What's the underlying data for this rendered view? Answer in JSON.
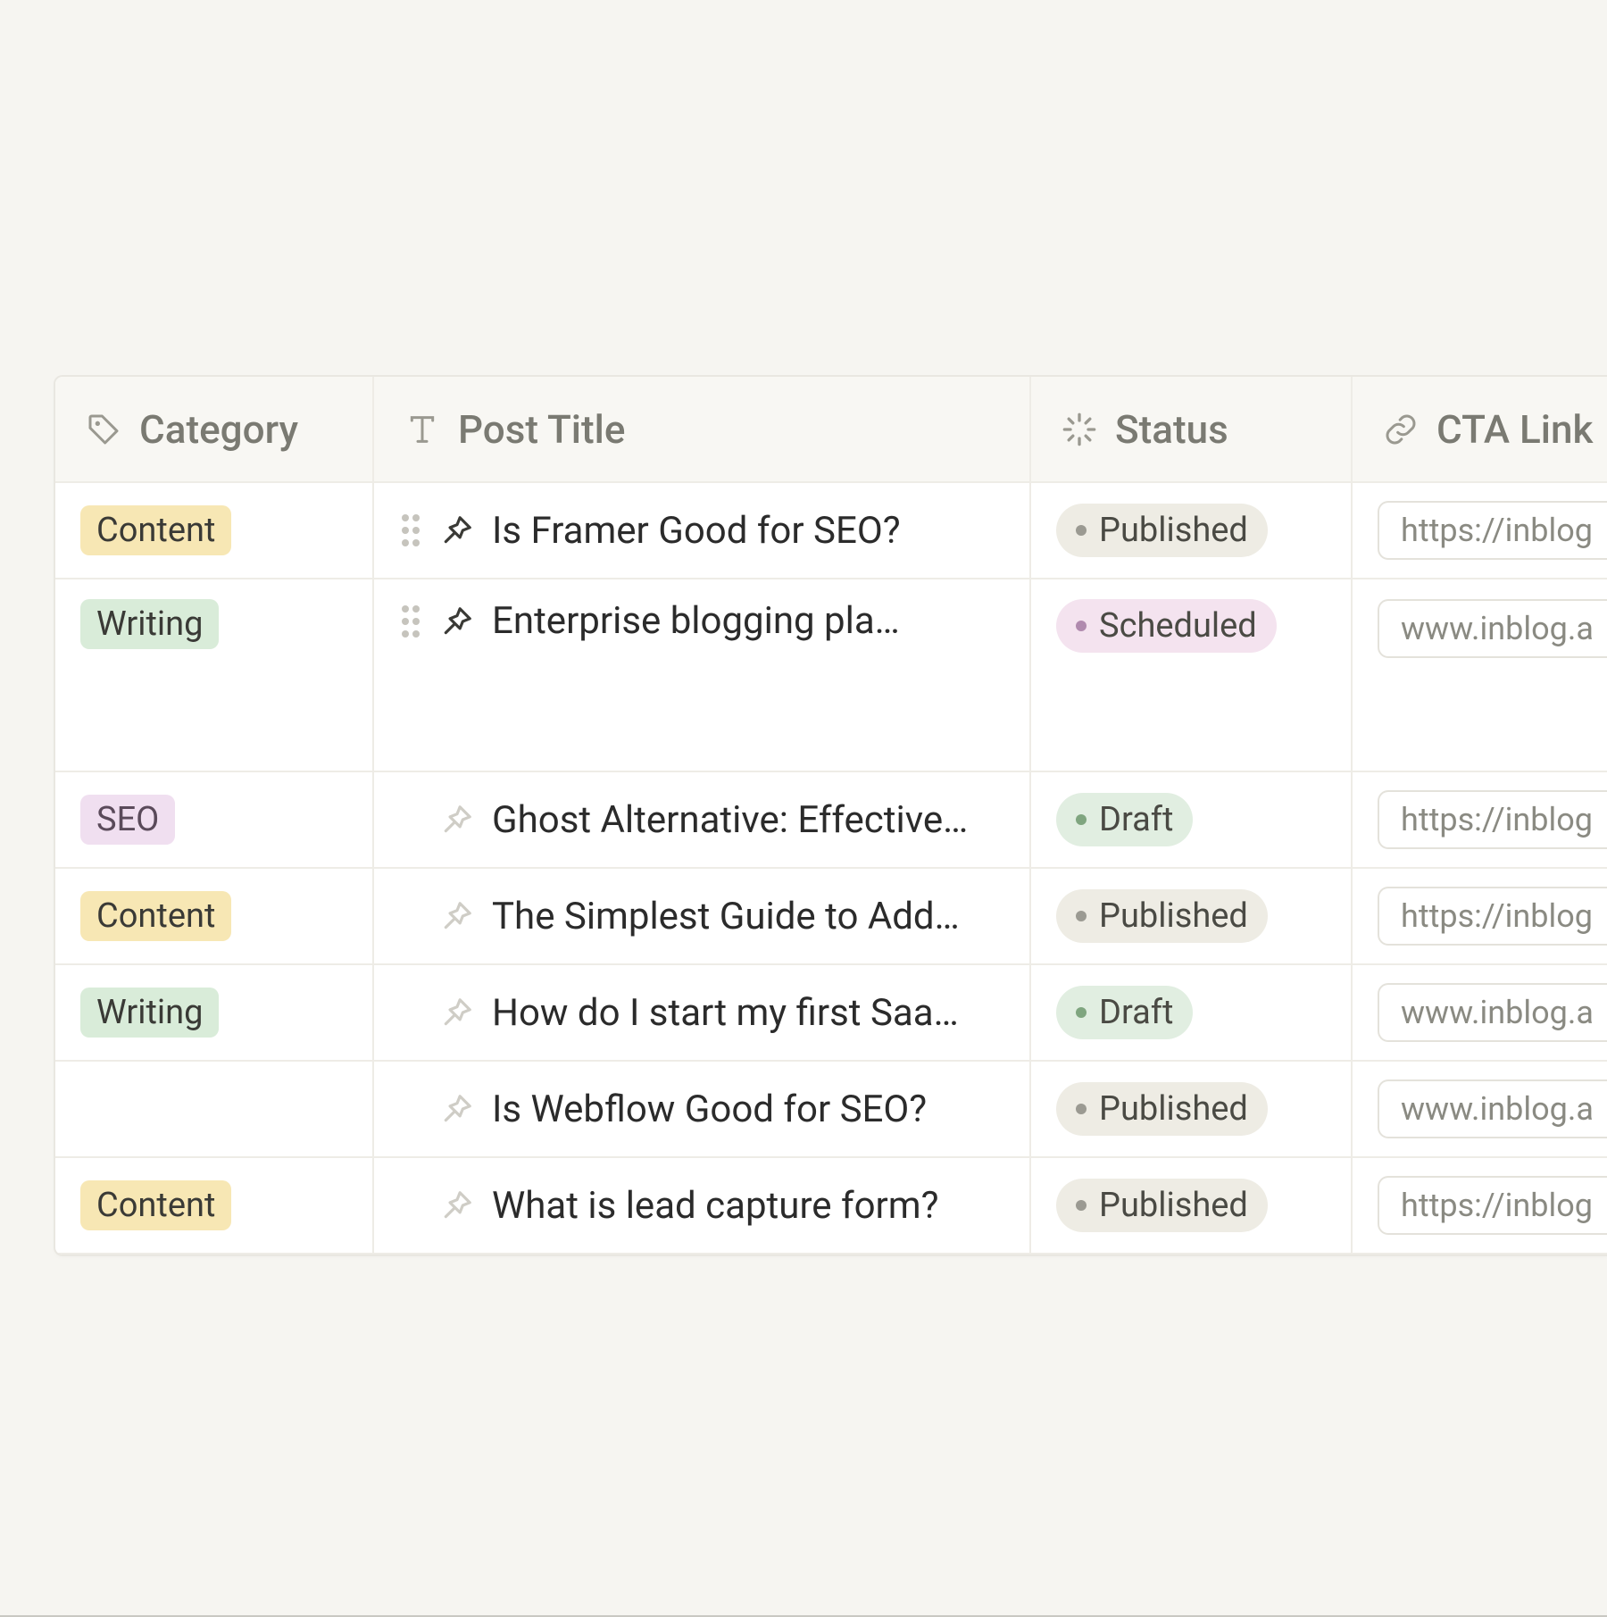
{
  "headers": {
    "category": "Category",
    "title": "Post Title",
    "status": "Status",
    "cta": "CTA Link"
  },
  "status_labels": {
    "published": "Published",
    "scheduled": "Scheduled",
    "draft": "Draft"
  },
  "categories": {
    "content": "Content",
    "writing": "Writing",
    "seo": "SEO"
  },
  "rows": [
    {
      "category": "content",
      "title": "Is Framer Good for SEO?",
      "status": "published",
      "link": "https://inblog",
      "drag": true,
      "pinned": true,
      "tall": false
    },
    {
      "category": "writing",
      "title": "Enterprise blogging pla…",
      "status": "scheduled",
      "link": "www.inblog.a",
      "drag": true,
      "pinned": true,
      "tall": true
    },
    {
      "category": "seo",
      "title": "Ghost Alternative: Effective…",
      "status": "draft",
      "link": "https://inblog",
      "drag": false,
      "pinned": false,
      "tall": false
    },
    {
      "category": "content",
      "title": "The Simplest Guide to Add…",
      "status": "published",
      "link": "https://inblog",
      "drag": false,
      "pinned": false,
      "tall": false
    },
    {
      "category": "writing",
      "title": "How do I start my first Saa…",
      "status": "draft",
      "link": "www.inblog.a",
      "drag": false,
      "pinned": false,
      "tall": false
    },
    {
      "category": "",
      "title": "Is Webflow Good for SEO?",
      "status": "published",
      "link": "www.inblog.a",
      "drag": false,
      "pinned": false,
      "tall": false
    },
    {
      "category": "content",
      "title": "What is lead capture form?",
      "status": "published",
      "link": "https://inblog",
      "drag": false,
      "pinned": false,
      "tall": false
    }
  ]
}
